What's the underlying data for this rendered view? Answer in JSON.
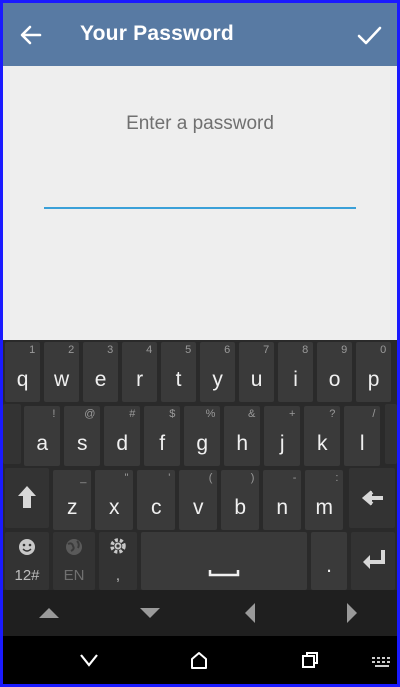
{
  "appbar": {
    "title": "Your Password"
  },
  "content": {
    "prompt": "Enter a password",
    "password_value": ""
  },
  "keyboard": {
    "row1": [
      {
        "key": "q",
        "hint": "1"
      },
      {
        "key": "w",
        "hint": "2"
      },
      {
        "key": "e",
        "hint": "3"
      },
      {
        "key": "r",
        "hint": "4"
      },
      {
        "key": "t",
        "hint": "5"
      },
      {
        "key": "y",
        "hint": "6"
      },
      {
        "key": "u",
        "hint": "7"
      },
      {
        "key": "i",
        "hint": "8"
      },
      {
        "key": "o",
        "hint": "9"
      },
      {
        "key": "p",
        "hint": "0"
      }
    ],
    "row2": [
      {
        "key": "a",
        "hint": "!"
      },
      {
        "key": "s",
        "hint": "@"
      },
      {
        "key": "d",
        "hint": "#"
      },
      {
        "key": "f",
        "hint": "$"
      },
      {
        "key": "g",
        "hint": "%"
      },
      {
        "key": "h",
        "hint": "&"
      },
      {
        "key": "j",
        "hint": "+"
      },
      {
        "key": "k",
        "hint": "?"
      },
      {
        "key": "l",
        "hint": "/"
      }
    ],
    "row3": [
      {
        "key": "z",
        "hint": "_"
      },
      {
        "key": "x",
        "hint": "\""
      },
      {
        "key": "c",
        "hint": "'"
      },
      {
        "key": "v",
        "hint": "("
      },
      {
        "key": "b",
        "hint": ")"
      },
      {
        "key": "n",
        "hint": "-"
      },
      {
        "key": "m",
        "hint": ":"
      }
    ],
    "symbols_label": "12#",
    "language_label": "EN",
    "comma_label": ",",
    "period_label": "."
  },
  "colors": {
    "appbar": "#587aa3",
    "input_underline": "#3aa0d8",
    "keyboard_bg": "#2a2a2a"
  }
}
